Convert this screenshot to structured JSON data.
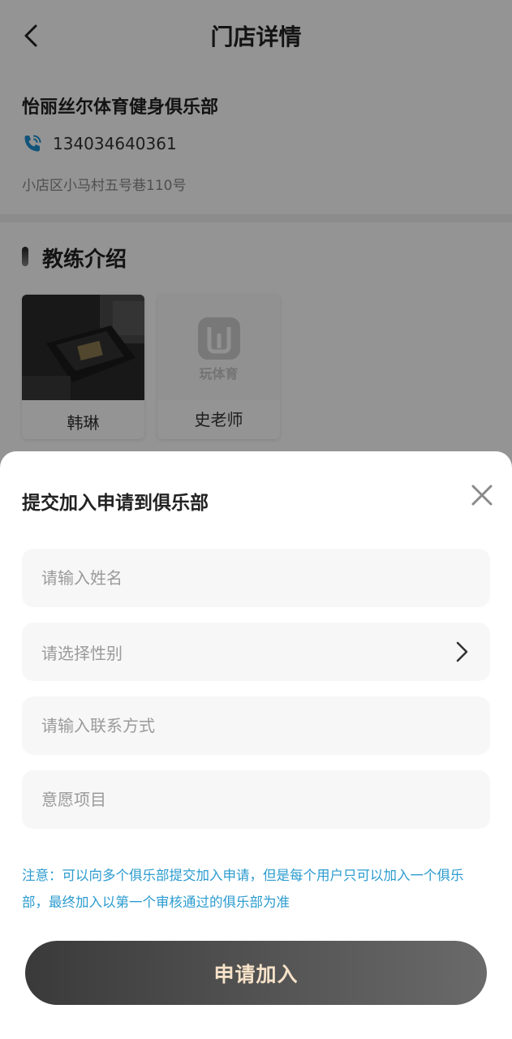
{
  "header": {
    "title": "门店详情"
  },
  "store": {
    "name": "怡丽丝尔体育健身俱乐部",
    "phone": "134034640361",
    "address": "小店区小马村五号巷110号"
  },
  "coaches": {
    "section_title": "教练介绍",
    "items": [
      {
        "name": "韩琳"
      },
      {
        "name": "史老师",
        "placeholder_logo_text": "玩体育"
      }
    ]
  },
  "modal": {
    "title": "提交加入申请到俱乐部",
    "name_placeholder": "请输入姓名",
    "gender_placeholder": "请选择性别",
    "contact_placeholder": "请输入联系方式",
    "project_placeholder": "意愿项目",
    "notice": "注意：可以向多个俱乐部提交加入申请，但是每个用户只可以加入一个俱乐部，最终加入以第一个审核通过的俱乐部为准",
    "submit_label": "申请加入"
  },
  "colors": {
    "notice": "#2b9bcf",
    "submit_text": "#f6e2c8",
    "phone_icon": "#1f8fd0"
  }
}
